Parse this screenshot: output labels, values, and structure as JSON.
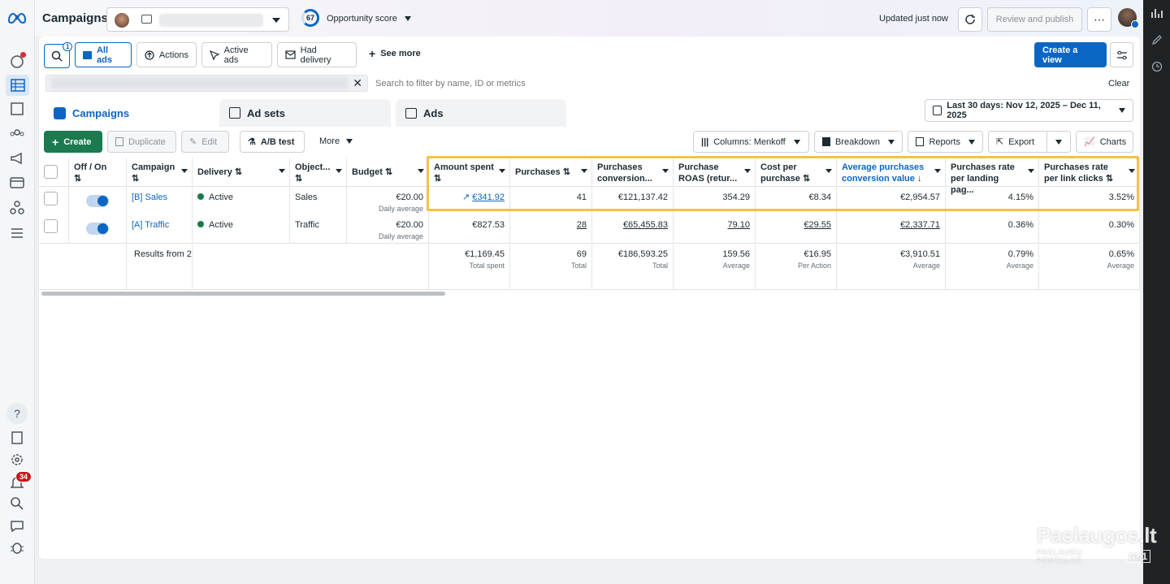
{
  "header": {
    "title": "Campaigns",
    "opportunity_score": "67",
    "opportunity_label": "Opportunity score",
    "updated": "Updated just now",
    "review_publish": "Review and publish",
    "more_dots": "⋯"
  },
  "toolbar": {
    "search_badge": "1",
    "all_ads": "All ads",
    "actions": "Actions",
    "active_ads": "Active ads",
    "had_delivery": "Had delivery",
    "see_more": "See more",
    "create_view": "Create a view"
  },
  "search": {
    "placeholder": "Search to filter by name, ID or metrics",
    "clear": "Clear"
  },
  "tabs": {
    "campaigns": "Campaigns",
    "adsets": "Ad sets",
    "ads": "Ads"
  },
  "date_range": "Last 30 days: Nov 12, 2025 – Dec 11, 2025",
  "actions_row": {
    "create": "Create",
    "duplicate": "Duplicate",
    "edit": "Edit",
    "ab_test": "A/B test",
    "more": "More",
    "columns": "Columns: Menkoff",
    "breakdown": "Breakdown",
    "reports": "Reports",
    "export": "Export",
    "charts": "Charts"
  },
  "columns": {
    "onoff": "Off / On",
    "campaign": "Campaign",
    "delivery": "Delivery",
    "objective": "Object...",
    "budget": "Budget",
    "amount_spent": "Amount spent",
    "purchases": "Purchases",
    "purchases_conv": "Purchases conversion...",
    "roas": "Purchase ROAS (retur...",
    "cost_per": "Cost per purchase",
    "avg_conv": "Average purchases conversion value",
    "rate_landing": "Purchases rate per landing pag...",
    "rate_link": "Purchases rate per link clicks"
  },
  "rows": [
    {
      "campaign": "[B] Sales",
      "delivery": "Active",
      "objective": "Sales",
      "budget": "€20.00",
      "budget_sub": "Daily average",
      "amount_spent": "€341.92",
      "purchases": "41",
      "purchases_conv": "€121,137.42",
      "roas": "354.29",
      "cost_per": "€8.34",
      "avg_conv": "€2,954.57",
      "rate_landing": "4.15%",
      "rate_link": "3.52%"
    },
    {
      "campaign": "[A] Traffic",
      "delivery": "Active",
      "objective": "Traffic",
      "budget": "€20.00",
      "budget_sub": "Daily average",
      "amount_spent": "€827.53",
      "purchases": "28",
      "purchases_conv": "€65,455.83",
      "roas": "79.10",
      "cost_per": "€29.55",
      "avg_conv": "€2,337.71",
      "rate_landing": "0.36%",
      "rate_link": "0.30%"
    }
  ],
  "totals": {
    "label": "Results from 2",
    "amount_spent": "€1,169.45",
    "amount_spent_sub": "Total spent",
    "purchases": "69",
    "purchases_sub": "Total",
    "purchases_conv": "€186,593.25",
    "purchases_conv_sub": "Total",
    "roas": "159.56",
    "roas_sub": "Average",
    "cost_per": "€16.95",
    "cost_per_sub": "Per Action",
    "avg_conv": "€3,910.51",
    "avg_conv_sub": "Average",
    "rate_landing": "0.79%",
    "rate_landing_sub": "Average",
    "rate_link": "0.65%",
    "rate_link_sub": "Average"
  },
  "leftbar": {
    "notif_count": "34"
  },
  "watermark": {
    "title": "Paslaugos.lt",
    "sub": "PASLAUGŲ PORTALAS",
    "badge": "Nr.1"
  }
}
